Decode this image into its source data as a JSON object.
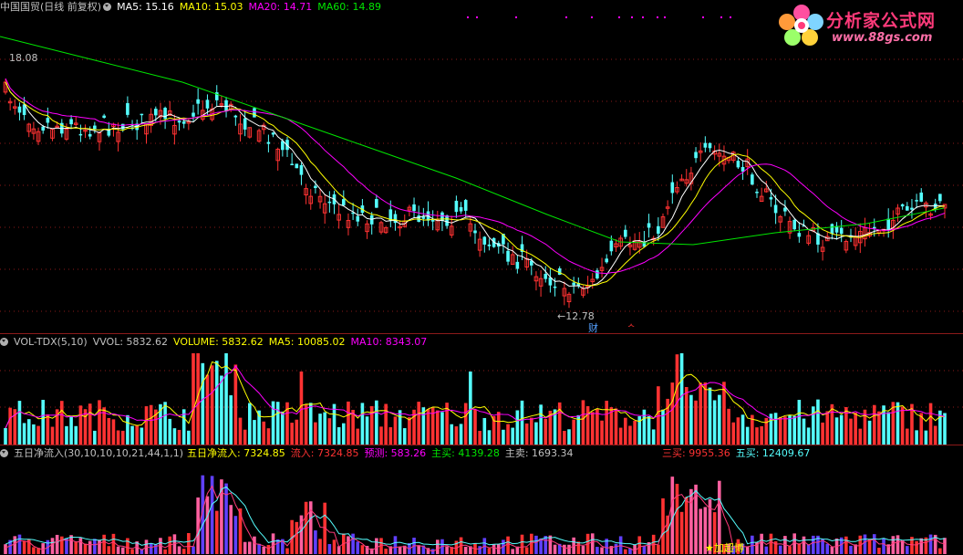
{
  "price_header": {
    "title": "中国国贸(日线 前复权)",
    "ma5_label": "MA5: 15.16",
    "ma10_label": "MA10: 15.03",
    "ma20_label": "MA20: 14.71",
    "ma60_label": "MA60: 14.89",
    "high_marker": "18.08",
    "low_marker": "12.78",
    "event_marker": "财"
  },
  "volume_header": {
    "indicator": "VOL-TDX(5,10)",
    "vvol_label": "VVOL: 5832.62",
    "volume_label": "VOLUME: 5832.62",
    "ma5_label": "MA5: 10085.02",
    "ma10_label": "MA10: 8343.07"
  },
  "flow_header": {
    "indicator": "五日净流入(30,10,10,10,21,44,1,1)",
    "net_inflow_label": "五日净流入: 7324.85",
    "inflow_label": "流入: 7324.85",
    "forecast_label": "预测: 583.26",
    "main_buy_label": "主买: 4139.28",
    "main_sell_label": "主卖: 1693.34",
    "third_buy_label": "三买: 9955.36",
    "fifth_buy_label": "五买: 12409.67",
    "star_text": "★加超博"
  },
  "logo": {
    "title": "分析家公式网",
    "url": "www.88gs.com"
  },
  "colors": {
    "up": "#ff3232",
    "down": "#54fcfc",
    "ma5": "#ffffff",
    "ma10": "#ffff00",
    "ma20": "#ff00ff",
    "ma60": "#00e600",
    "grid": "#8c1a1a"
  }
}
